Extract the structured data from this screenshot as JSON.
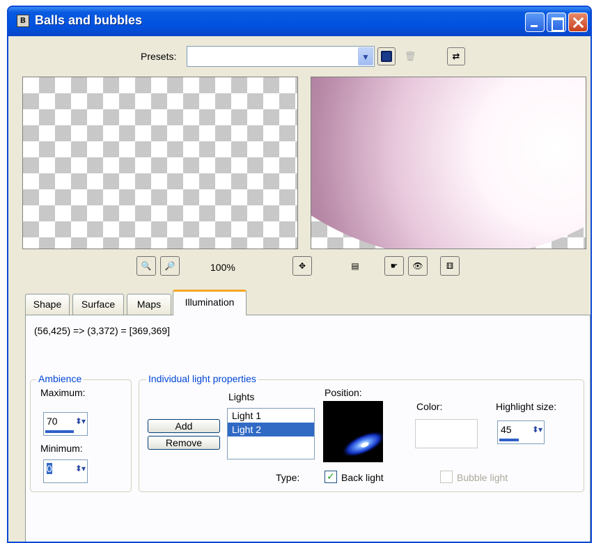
{
  "window": {
    "title": "Balls and bubbles",
    "icon": "B"
  },
  "presets": {
    "label": "Presets:",
    "value": ""
  },
  "zoom": {
    "level": "100%"
  },
  "tabs": [
    "Shape",
    "Surface",
    "Maps",
    "Illumination"
  ],
  "illumination": {
    "coords": "(56,425) => (3,372) = [369,369]",
    "ambience": {
      "title": "Ambience",
      "max_label": "Maximum:",
      "max_value": "70",
      "max_fill": 0.7,
      "min_label": "Minimum:",
      "min_value": "0",
      "min_fill": 0.0
    },
    "lights": {
      "title": "Individual light properties",
      "list_label": "Lights",
      "add_label": "Add",
      "remove_label": "Remove",
      "items": [
        "Light 1",
        "Light 2"
      ],
      "selected_index": 1,
      "position_label": "Position:",
      "color_label": "Color:",
      "color_value": "#ffffff",
      "highlight_label": "Highlight size:",
      "highlight_value": "45",
      "highlight_fill": 0.45,
      "type_label": "Type:",
      "back_light_label": "Back light",
      "back_light_checked": true,
      "bubble_light_label": "Bubble light",
      "bubble_light_checked": false
    }
  }
}
